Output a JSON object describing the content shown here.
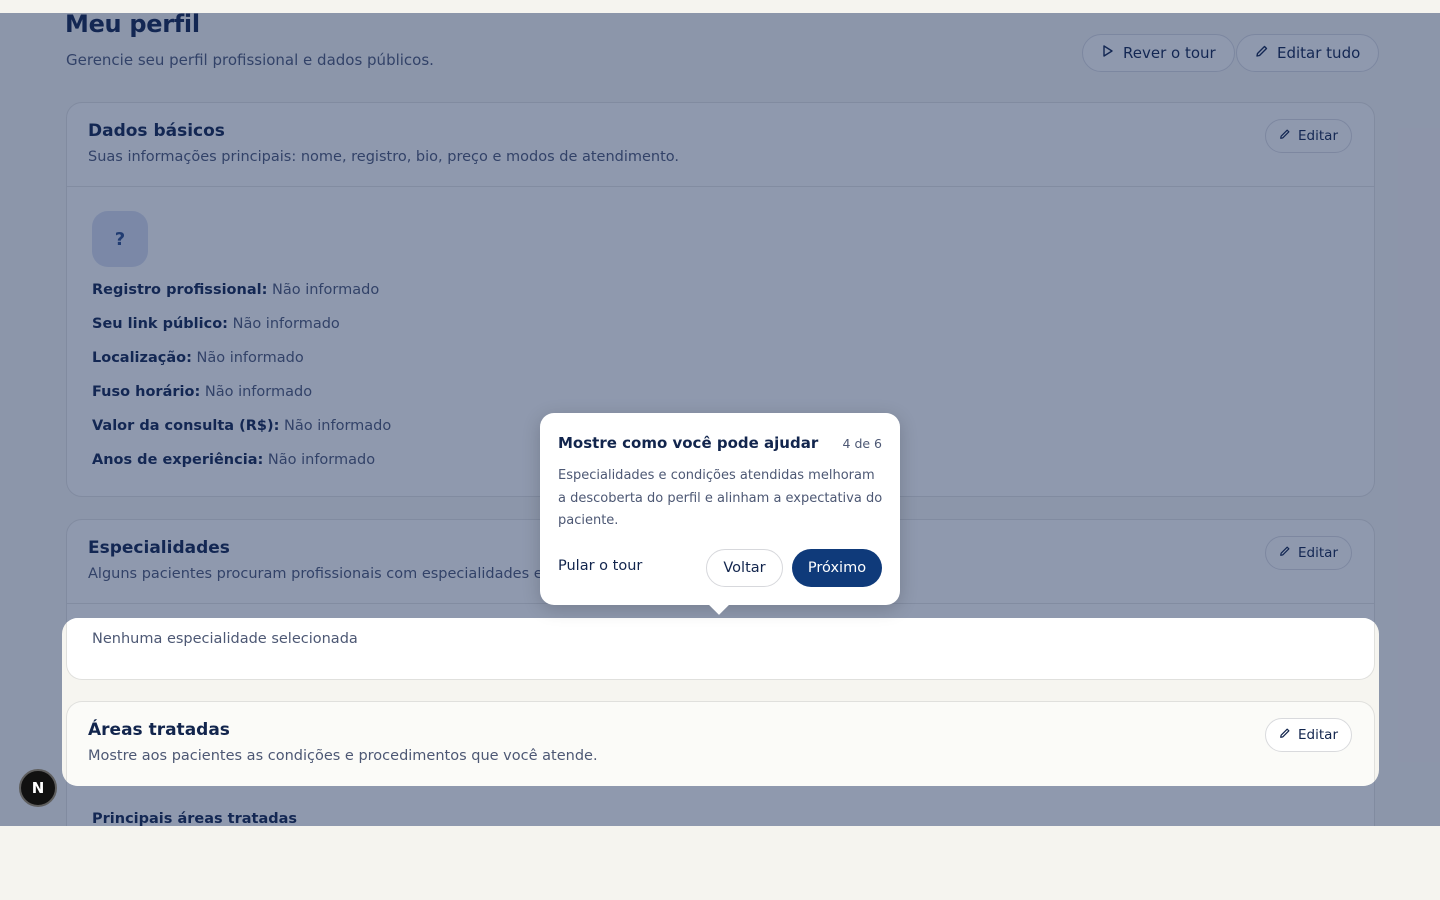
{
  "header": {
    "title": "Meu perfil",
    "subtitle": "Gerencie seu perfil profissional e dados públicos.",
    "tour_button": "Rever o tour",
    "edit_all_button": "Editar tudo"
  },
  "basic": {
    "title": "Dados básicos",
    "description": "Suas informações principais: nome, registro, bio, preço e modos de atendimento.",
    "edit": "Editar",
    "avatar_placeholder": "?",
    "fields": [
      {
        "label": "Registro profissional:",
        "value": "Não informado"
      },
      {
        "label": "Seu link público:",
        "value": "Não informado"
      },
      {
        "label": "Localização:",
        "value": "Não informado"
      },
      {
        "label": "Fuso horário:",
        "value": "Não informado"
      },
      {
        "label": "Valor da consulta (R$):",
        "value": "Não informado"
      },
      {
        "label": "Anos de experiência:",
        "value": "Não informado"
      }
    ]
  },
  "specialties": {
    "title": "Especialidades",
    "description": "Alguns pacientes procuram profissionais com especialidades específicas.",
    "edit": "Editar",
    "empty": "Nenhuma especialidade selecionada"
  },
  "areas": {
    "title": "Áreas tratadas",
    "description": "Mostre aos pacientes as condições e procedimentos que você atende.",
    "edit": "Editar",
    "section_label": "Principais áreas tratadas"
  },
  "tour": {
    "title": "Mostre como você pode ajudar",
    "step": "4 de 6",
    "text": "Especialidades e condições atendidas melhoram a descoberta do perfil e alinham a expectativa do paciente.",
    "skip": "Pular o tour",
    "back": "Voltar",
    "next": "Próximo"
  },
  "devtools": {
    "badge": "N"
  },
  "icons": {
    "tour": "play-icon",
    "edit": "pencil-icon"
  },
  "colors": {
    "primary": "#0f3a7a",
    "overlay": "#162a5c",
    "text": "#12254d"
  }
}
